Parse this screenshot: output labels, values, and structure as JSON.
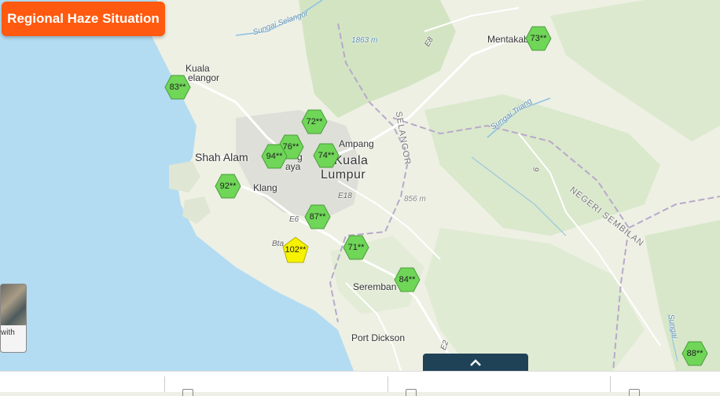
{
  "header": {
    "title": "Regional Haze Situation"
  },
  "places": {
    "kuala_selangor_1": "Kuala",
    "kuala_selangor_2": "elangor",
    "shah_alam": "Shah Alam",
    "klang": "Klang",
    "ampang": "Ampang",
    "kuala_lumpur_1": "Kuala",
    "kuala_lumpur_2": "Lumpur",
    "seremban": "Seremban",
    "port_dickson": "Port Dickson",
    "mentakab": "Mentakab",
    "jaya_fragment": "aya",
    "sel_fragment": "g"
  },
  "elevations": {
    "peak1": "1863 m",
    "peak2": "856 m"
  },
  "rivers": {
    "r1": "Sungai Selangor",
    "r2": "Sungai Triang",
    "r3": "Sungai"
  },
  "roads": {
    "e8": "E8",
    "e18": "E18",
    "e6": "E6",
    "e2": "E2",
    "bta": "Bta",
    "r9": "9"
  },
  "states": {
    "selangor": "SELANGOR",
    "negeri": "NEGERI SEMBILAN"
  },
  "basemap_thumb": {
    "label": "with"
  },
  "stations": [
    {
      "id": "kuala-selangor",
      "value": "83**",
      "shape": "hexagon",
      "color": "#6fd657"
    },
    {
      "id": "mentakab",
      "value": "73**",
      "shape": "hexagon",
      "color": "#6fd657"
    },
    {
      "id": "gombak",
      "value": "72**",
      "shape": "hexagon",
      "color": "#6fd657"
    },
    {
      "id": "petaling-jaya",
      "value": "76**",
      "shape": "hexagon",
      "color": "#6fd657"
    },
    {
      "id": "shah-alam",
      "value": "94**",
      "shape": "hexagon",
      "color": "#6fd657"
    },
    {
      "id": "cheras",
      "value": "74**",
      "shape": "hexagon",
      "color": "#6fd657"
    },
    {
      "id": "klang",
      "value": "92**",
      "shape": "hexagon",
      "color": "#6fd657"
    },
    {
      "id": "putrajaya",
      "value": "87**",
      "shape": "hexagon",
      "color": "#6fd657"
    },
    {
      "id": "banting",
      "value": "102**",
      "shape": "pentagon",
      "color": "#f6f200"
    },
    {
      "id": "nilai",
      "value": "71**",
      "shape": "hexagon",
      "color": "#6fd657"
    },
    {
      "id": "seremban",
      "value": "84**",
      "shape": "hexagon",
      "color": "#6fd657"
    },
    {
      "id": "port-dickson-east",
      "value": "88**",
      "shape": "hexagon",
      "color": "#6fd657"
    }
  ],
  "colors": {
    "sea": "#b3dcf2",
    "land": "#eef0e4",
    "forest": "#d6e6c6",
    "urban": "#dcdcd6",
    "accent": "#ff5a0f",
    "panel": "#1f4257"
  }
}
